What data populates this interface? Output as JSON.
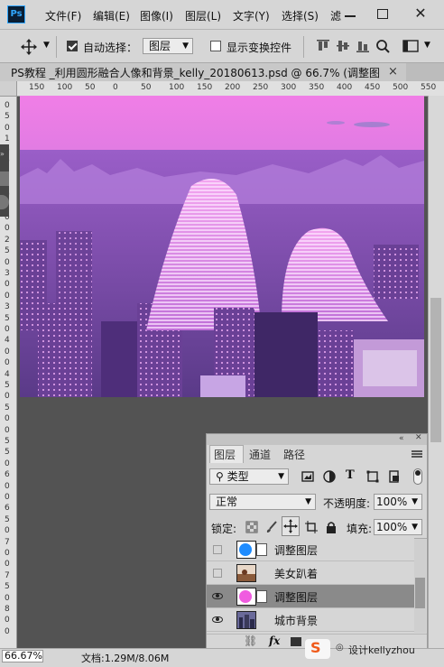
{
  "app": {
    "logo": "Ps"
  },
  "menu": {
    "items": [
      "文件(F)",
      "编辑(E)",
      "图像(I)",
      "图层(L)",
      "文字(Y)",
      "选择(S)",
      "滤"
    ]
  },
  "options": {
    "auto_select_label": "自动选择：",
    "auto_select_value": "图层",
    "show_transform_label": "显示变换控件"
  },
  "document": {
    "tab_title": "PS教程 _利用圆形融合人像和背景_kelly_20180613.psd @ 66.7% (调整图...",
    "close_glyph": "×"
  },
  "ruler": {
    "h_ticks": [
      "150",
      "100",
      "50",
      "0",
      "50",
      "100",
      "150",
      "200",
      "250",
      "300",
      "350",
      "400",
      "450",
      "500",
      "550"
    ],
    "v_ticks": [
      "0",
      "5",
      "0",
      "1",
      "0",
      "0",
      "1",
      "5",
      "0",
      "2",
      "0",
      "0",
      "2",
      "5",
      "0",
      "3",
      "0",
      "0",
      "3",
      "5",
      "0",
      "4",
      "0",
      "0",
      "4",
      "5",
      "0",
      "5",
      "0",
      "0",
      "5",
      "5",
      "0",
      "6",
      "0",
      "0",
      "6",
      "5",
      "0",
      "7",
      "0",
      "0",
      "7",
      "5",
      "0",
      "8",
      "0",
      "0"
    ]
  },
  "layers_panel": {
    "tabs": [
      "图层",
      "通道",
      "路径"
    ],
    "filter_kind": "类型",
    "blend_mode": "正常",
    "opacity_label": "不透明度:",
    "opacity_value": "100%",
    "lock_label": "锁定:",
    "fill_label": "填充:",
    "fill_value": "100%",
    "layers": [
      {
        "name": "调整图层",
        "visible": false,
        "thumb": "blue-circle"
      },
      {
        "name": "美女趴着",
        "visible": false,
        "thumb": "photo"
      },
      {
        "name": "调整图层",
        "visible": true,
        "thumb": "pink-circle",
        "selected": true
      },
      {
        "name": "城市背景",
        "visible": true,
        "thumb": "city"
      }
    ],
    "footer_fx": "fx"
  },
  "status": {
    "zoom": "66.67%",
    "doc_info": "文档:1.29M/8.06M"
  },
  "watermark": {
    "text": "设计kellyzhou"
  },
  "colors": {
    "overlay_pink": "#e070e8",
    "overlay_purple": "#8a4fd0",
    "ps_blue": "#31a8ff"
  }
}
